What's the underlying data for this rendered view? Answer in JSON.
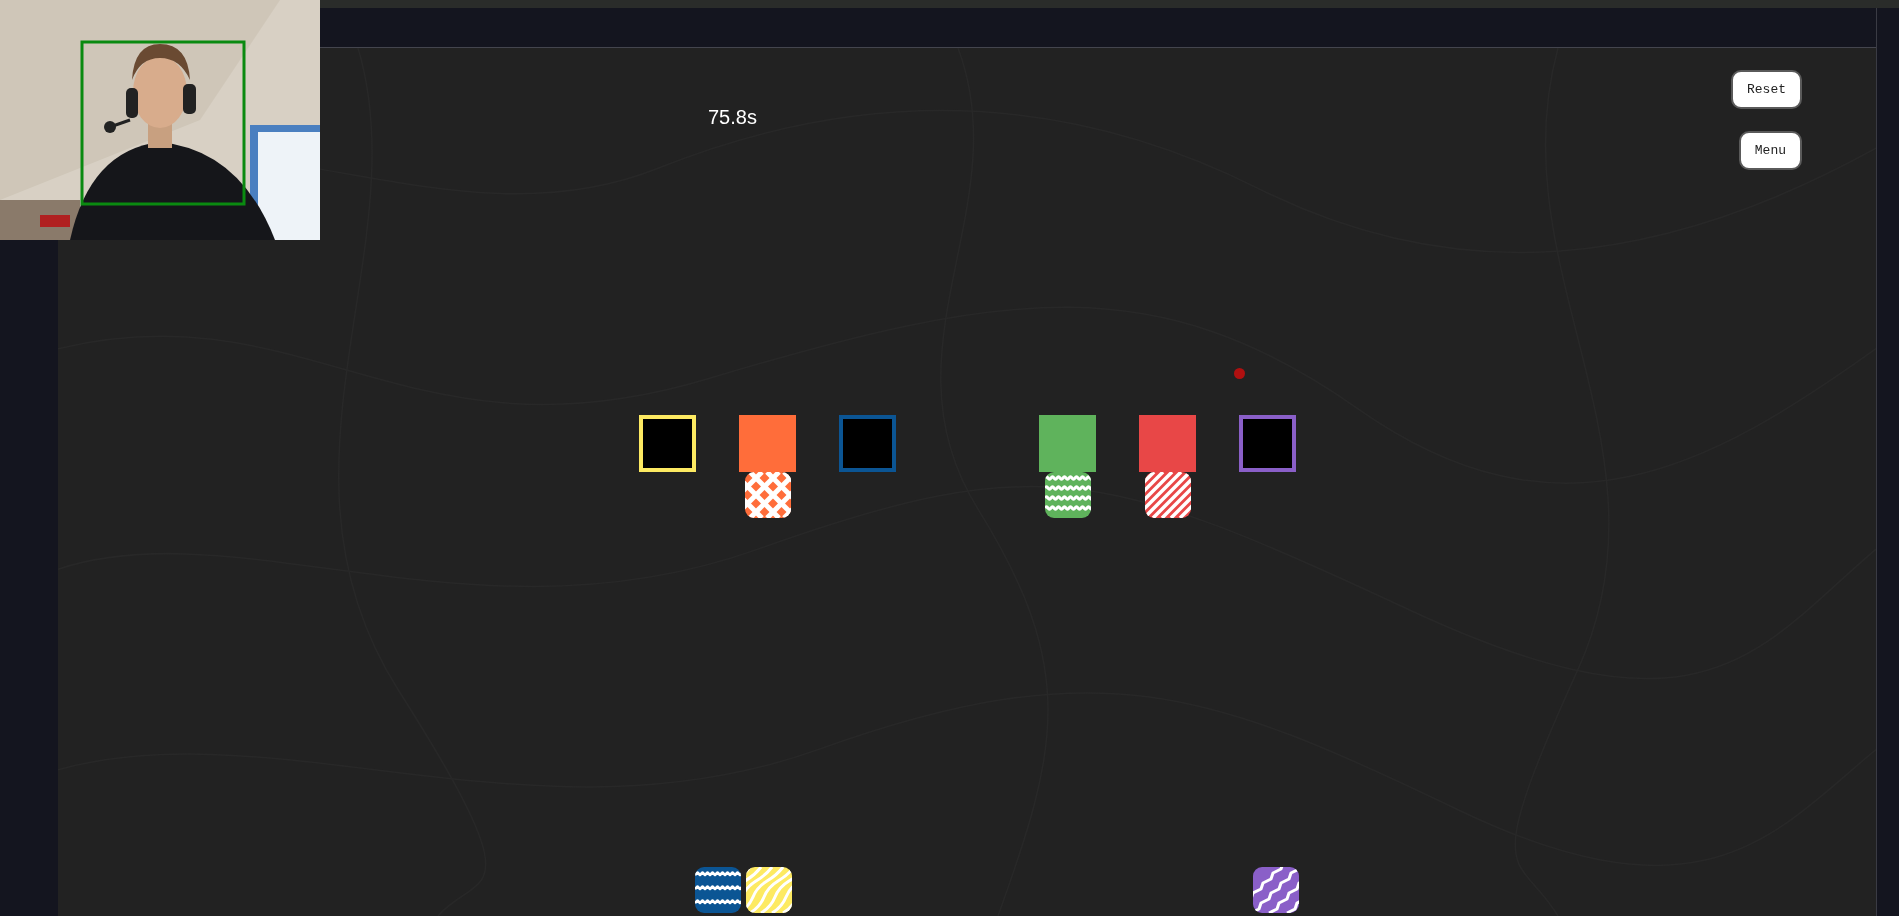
{
  "timer": "75.8s",
  "buttons": [
    {
      "label": "Reset"
    },
    {
      "label": "Menu"
    }
  ],
  "cursor": {
    "shown": true
  },
  "slots": [
    {
      "color": "#fdea62",
      "filled": false
    },
    {
      "color": "#ff6d3a",
      "filled": true,
      "tile": {
        "kind": "crosshatch"
      }
    },
    {
      "color": "#0b5594",
      "filled": false
    },
    {
      "color": "#5fb35c",
      "filled": true,
      "tile": {
        "kind": "waves"
      }
    },
    {
      "color": "#e84747",
      "filled": true,
      "tile": {
        "kind": "stripes"
      }
    },
    {
      "color": "#8a5fc8",
      "filled": false
    }
  ],
  "loose_tiles": [
    {
      "color": "#0b5594",
      "kind": "zigzag"
    },
    {
      "color": "#fdea62",
      "kind": "diagonal-waves"
    },
    {
      "color": "#8a5fc8",
      "kind": "steps"
    }
  ]
}
